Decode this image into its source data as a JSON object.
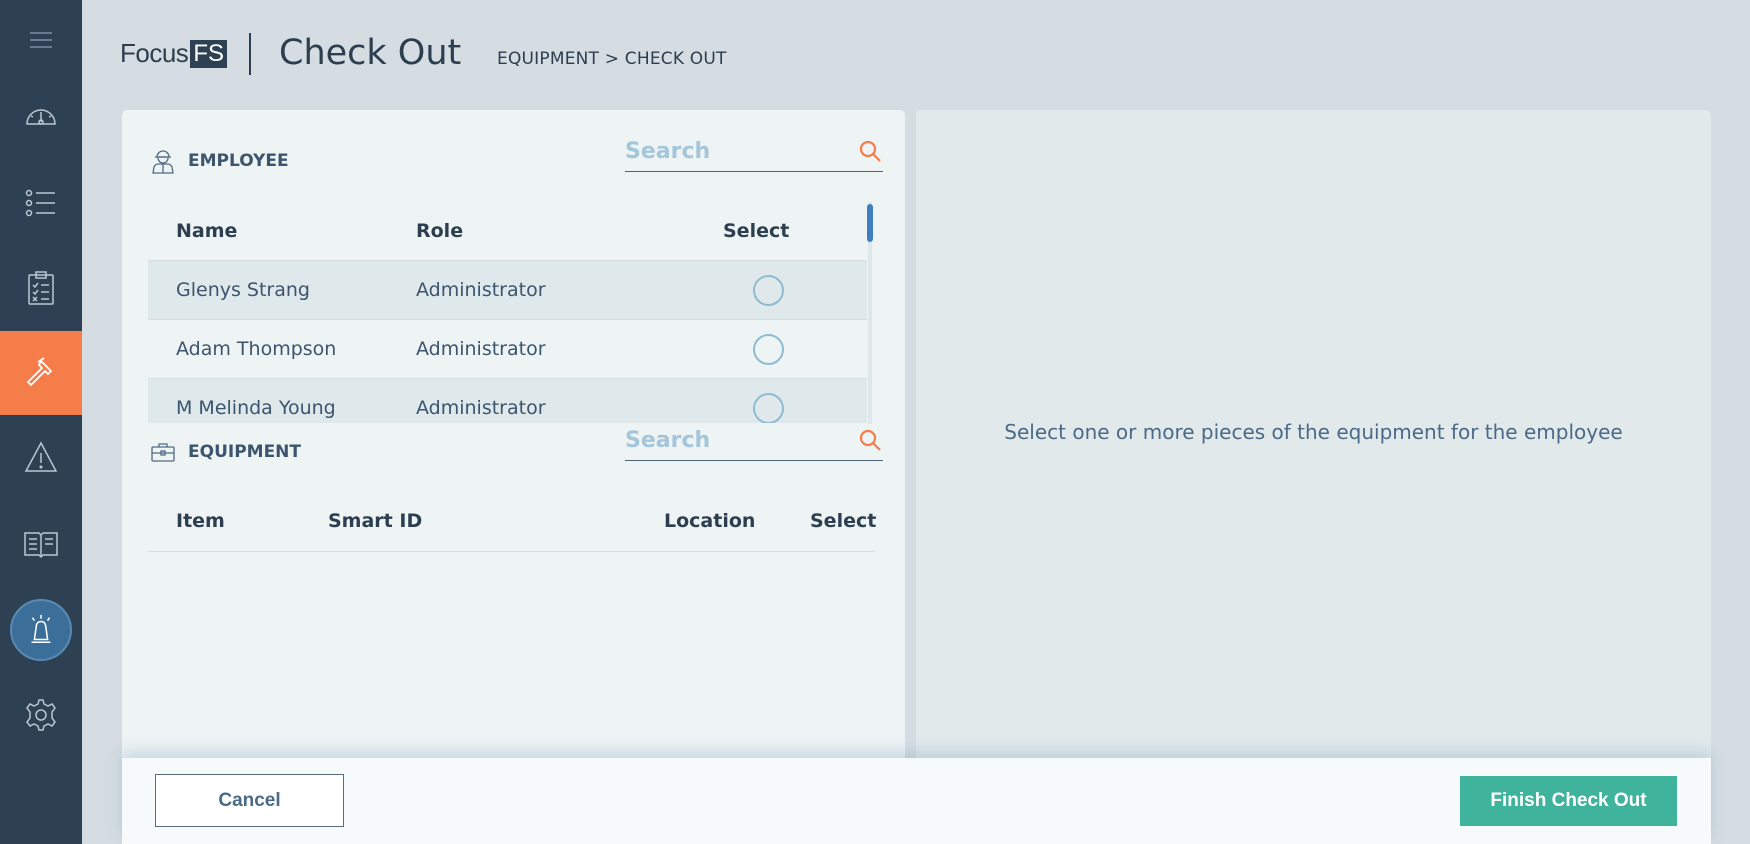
{
  "header": {
    "logo_text": "Focus",
    "logo_box": "FS",
    "title": "Check Out",
    "breadcrumb": "EQUIPMENT > CHECK OUT"
  },
  "sidebar": {
    "items": [
      {
        "name": "dashboard",
        "icon": "gauge-icon"
      },
      {
        "name": "list",
        "icon": "list-icon"
      },
      {
        "name": "checklist",
        "icon": "clipboard-icon"
      },
      {
        "name": "equipment",
        "icon": "hammer-icon",
        "active": true
      },
      {
        "name": "alerts",
        "icon": "warning-icon"
      },
      {
        "name": "manual",
        "icon": "book-icon"
      },
      {
        "name": "emergency",
        "icon": "siren-icon"
      },
      {
        "name": "settings",
        "icon": "gear-icon"
      }
    ]
  },
  "employee": {
    "label": "EMPLOYEE",
    "search_placeholder": "Search",
    "columns": {
      "name": "Name",
      "role": "Role",
      "select": "Select"
    },
    "rows": [
      {
        "name": "Glenys Strang",
        "role": "Administrator"
      },
      {
        "name": "Adam Thompson",
        "role": "Administrator"
      },
      {
        "name": "M Melinda Young",
        "role": "Administrator"
      }
    ]
  },
  "equipment": {
    "label": "EQUIPMENT",
    "search_placeholder": "Search",
    "columns": {
      "item": "Item",
      "smart_id": "Smart ID",
      "location": "Location",
      "select": "Select"
    }
  },
  "right_panel": {
    "message": "Select one or more pieces of the equipment for the employee"
  },
  "footer": {
    "cancel_label": "Cancel",
    "finish_label": "Finish Check Out"
  },
  "colors": {
    "sidebar": "#2e4152",
    "active": "#f47d4a",
    "accent_green": "#3fb39b",
    "search_icon": "#f47d4a"
  }
}
